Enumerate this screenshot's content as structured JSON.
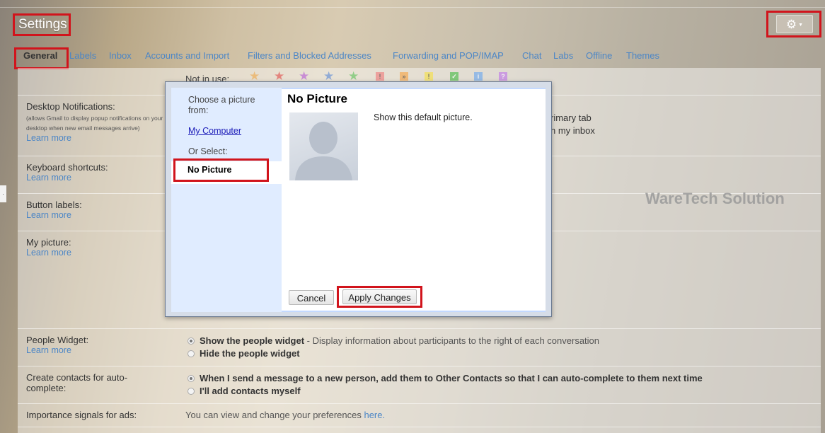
{
  "header": {
    "title": "Settings"
  },
  "tabs": [
    "General",
    "Labels",
    "Inbox",
    "Accounts and Import",
    "Filters and Blocked Addresses",
    "Forwarding and POP/IMAP",
    "Chat",
    "Labs",
    "Offline",
    "Themes"
  ],
  "stars_row": {
    "label": "Not in use:"
  },
  "desktop_notifications": {
    "label": "Desktop Notifications:",
    "desc_line1": "(allows Gmail to display popup notifications on your",
    "desc_line2": "desktop when new email messages arrive)",
    "learn_more": "Learn more",
    "partial_line1": "rimary tab",
    "partial_line2": "n my inbox"
  },
  "keyboard_shortcuts": {
    "label": "Keyboard shortcuts:",
    "learn_more": "Learn more"
  },
  "button_labels": {
    "label": "Button labels:",
    "learn_more": "Learn more"
  },
  "my_picture": {
    "label": "My picture:",
    "learn_more": "Learn more"
  },
  "people_widget": {
    "label": "People Widget:",
    "learn_more": "Learn more",
    "option1_bold": "Show the people widget",
    "option1_rest": " - Display information about participants to the right of each conversation",
    "option2": "Hide the people widget"
  },
  "create_contacts": {
    "label_line1": "Create contacts for auto-",
    "label_line2": "complete:",
    "option1": "When I send a message to a new person, add them to Other Contacts so that I can auto-complete to them next time",
    "option2": "I'll add contacts myself"
  },
  "importance_signals": {
    "label": "Importance signals for ads:",
    "text": "You can view and change your preferences ",
    "link": "here."
  },
  "watermark": "WareTech Solution",
  "dialog": {
    "side_prompt_line1": "Choose a picture",
    "side_prompt_line2": "from:",
    "my_computer": "My Computer",
    "or_select": "Or Select:",
    "no_picture_item": "No Picture",
    "title": "No Picture",
    "description": "Show this default picture.",
    "cancel": "Cancel",
    "apply": "Apply Changes"
  },
  "colors": {
    "accent_red": "#d1141c",
    "link_blue": "#4c86c6",
    "dialog_blue": "#c3d9ff"
  }
}
